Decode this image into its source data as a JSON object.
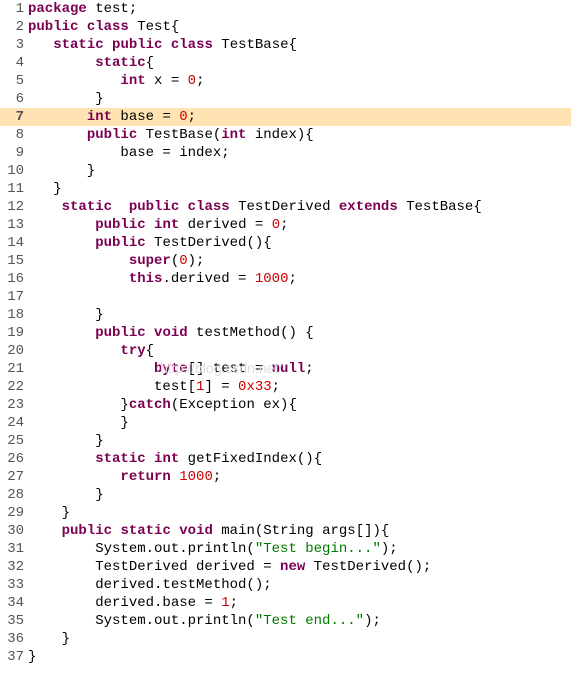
{
  "lines": [
    {
      "n": "1",
      "hl": false,
      "seg": [
        [
          "kw",
          "package"
        ],
        [
          "",
          " test;"
        ]
      ]
    },
    {
      "n": "2",
      "hl": false,
      "seg": [
        [
          "kw",
          "public"
        ],
        [
          "",
          " "
        ],
        [
          "kw",
          "class"
        ],
        [
          "",
          " Test{"
        ]
      ]
    },
    {
      "n": "3",
      "hl": false,
      "seg": [
        [
          "",
          "   "
        ],
        [
          "kw",
          "static"
        ],
        [
          "",
          " "
        ],
        [
          "kw",
          "public"
        ],
        [
          "",
          " "
        ],
        [
          "kw",
          "class"
        ],
        [
          "",
          " TestBase{"
        ]
      ]
    },
    {
      "n": "4",
      "hl": false,
      "seg": [
        [
          "",
          "        "
        ],
        [
          "kw",
          "static"
        ],
        [
          "",
          "{"
        ]
      ]
    },
    {
      "n": "5",
      "hl": false,
      "seg": [
        [
          "",
          "           "
        ],
        [
          "kw",
          "int"
        ],
        [
          "",
          " x = "
        ],
        [
          "num",
          "0"
        ],
        [
          "",
          ";"
        ]
      ]
    },
    {
      "n": "6",
      "hl": false,
      "seg": [
        [
          "",
          "        }"
        ]
      ]
    },
    {
      "n": "7",
      "hl": true,
      "seg": [
        [
          "",
          "       "
        ],
        [
          "kw",
          "int"
        ],
        [
          "",
          " base = "
        ],
        [
          "num",
          "0"
        ],
        [
          "",
          ";"
        ]
      ]
    },
    {
      "n": "8",
      "hl": false,
      "seg": [
        [
          "",
          "       "
        ],
        [
          "kw",
          "public"
        ],
        [
          "",
          " TestBase("
        ],
        [
          "kw",
          "int"
        ],
        [
          "",
          " index){"
        ]
      ]
    },
    {
      "n": "9",
      "hl": false,
      "seg": [
        [
          "",
          "           base = index;"
        ]
      ]
    },
    {
      "n": "10",
      "hl": false,
      "seg": [
        [
          "",
          "       }"
        ]
      ]
    },
    {
      "n": "11",
      "hl": false,
      "seg": [
        [
          "",
          "   }"
        ]
      ]
    },
    {
      "n": "12",
      "hl": false,
      "seg": [
        [
          "",
          "    "
        ],
        [
          "kw",
          "static"
        ],
        [
          "",
          "  "
        ],
        [
          "kw",
          "public"
        ],
        [
          "",
          " "
        ],
        [
          "kw",
          "class"
        ],
        [
          "",
          " TestDerived "
        ],
        [
          "kw",
          "extends"
        ],
        [
          "",
          " TestBase{"
        ]
      ]
    },
    {
      "n": "13",
      "hl": false,
      "seg": [
        [
          "",
          "        "
        ],
        [
          "kw",
          "public"
        ],
        [
          "",
          " "
        ],
        [
          "kw",
          "int"
        ],
        [
          "",
          " derived = "
        ],
        [
          "num",
          "0"
        ],
        [
          "",
          ";"
        ]
      ]
    },
    {
      "n": "14",
      "hl": false,
      "seg": [
        [
          "",
          "        "
        ],
        [
          "kw",
          "public"
        ],
        [
          "",
          " TestDerived(){"
        ]
      ]
    },
    {
      "n": "15",
      "hl": false,
      "seg": [
        [
          "",
          "            "
        ],
        [
          "kw",
          "super"
        ],
        [
          "",
          "("
        ],
        [
          "num",
          "0"
        ],
        [
          "",
          ");"
        ]
      ]
    },
    {
      "n": "16",
      "hl": false,
      "seg": [
        [
          "",
          "            "
        ],
        [
          "kw",
          "this"
        ],
        [
          "",
          ".derived = "
        ],
        [
          "num",
          "1000"
        ],
        [
          "",
          ";"
        ]
      ]
    },
    {
      "n": "17",
      "hl": false,
      "seg": [
        [
          "",
          ""
        ]
      ]
    },
    {
      "n": "18",
      "hl": false,
      "seg": [
        [
          "",
          "        }"
        ]
      ]
    },
    {
      "n": "19",
      "hl": false,
      "seg": [
        [
          "",
          "        "
        ],
        [
          "kw",
          "public"
        ],
        [
          "",
          " "
        ],
        [
          "kw",
          "void"
        ],
        [
          "",
          " testMethod() {"
        ]
      ]
    },
    {
      "n": "20",
      "hl": false,
      "seg": [
        [
          "",
          "           "
        ],
        [
          "kw",
          "try"
        ],
        [
          "",
          "{"
        ]
      ]
    },
    {
      "n": "21",
      "hl": false,
      "seg": [
        [
          "",
          "               "
        ],
        [
          "kw",
          "byte"
        ],
        [
          "",
          "[] test = "
        ],
        [
          "kw",
          "null"
        ],
        [
          "",
          ";"
        ]
      ]
    },
    {
      "n": "22",
      "hl": false,
      "seg": [
        [
          "",
          "               test["
        ],
        [
          "num",
          "1"
        ],
        [
          "",
          "] = "
        ],
        [
          "num",
          "0x33"
        ],
        [
          "",
          ";"
        ]
      ]
    },
    {
      "n": "23",
      "hl": false,
      "seg": [
        [
          "",
          "           }"
        ],
        [
          "kw",
          "catch"
        ],
        [
          "",
          "(Exception ex){"
        ]
      ]
    },
    {
      "n": "24",
      "hl": false,
      "seg": [
        [
          "",
          "           }"
        ]
      ]
    },
    {
      "n": "25",
      "hl": false,
      "seg": [
        [
          "",
          "        }"
        ]
      ]
    },
    {
      "n": "26",
      "hl": false,
      "seg": [
        [
          "",
          "        "
        ],
        [
          "kw",
          "static"
        ],
        [
          "",
          " "
        ],
        [
          "kw",
          "int"
        ],
        [
          "",
          " getFixedIndex(){"
        ]
      ]
    },
    {
      "n": "27",
      "hl": false,
      "seg": [
        [
          "",
          "           "
        ],
        [
          "kw",
          "return"
        ],
        [
          "",
          " "
        ],
        [
          "num",
          "1000"
        ],
        [
          "",
          ";"
        ]
      ]
    },
    {
      "n": "28",
      "hl": false,
      "seg": [
        [
          "",
          "        }"
        ]
      ]
    },
    {
      "n": "29",
      "hl": false,
      "seg": [
        [
          "",
          "    }"
        ]
      ]
    },
    {
      "n": "30",
      "hl": false,
      "seg": [
        [
          "",
          "    "
        ],
        [
          "kw",
          "public"
        ],
        [
          "",
          " "
        ],
        [
          "kw",
          "static"
        ],
        [
          "",
          " "
        ],
        [
          "kw",
          "void"
        ],
        [
          "",
          " main(String args[]){"
        ]
      ]
    },
    {
      "n": "31",
      "hl": false,
      "seg": [
        [
          "",
          "        System.out.println("
        ],
        [
          "str",
          "\"Test begin...\""
        ],
        [
          "",
          ");"
        ]
      ]
    },
    {
      "n": "32",
      "hl": false,
      "seg": [
        [
          "",
          "        TestDerived derived = "
        ],
        [
          "kw",
          "new"
        ],
        [
          "",
          " TestDerived();"
        ]
      ]
    },
    {
      "n": "33",
      "hl": false,
      "seg": [
        [
          "",
          "        derived.testMethod();"
        ]
      ]
    },
    {
      "n": "34",
      "hl": false,
      "seg": [
        [
          "",
          "        derived.base = "
        ],
        [
          "num",
          "1"
        ],
        [
          "",
          ";"
        ]
      ]
    },
    {
      "n": "35",
      "hl": false,
      "seg": [
        [
          "",
          "        System.out.println("
        ],
        [
          "str",
          "\"Test end...\""
        ],
        [
          "",
          ");"
        ]
      ]
    },
    {
      "n": "36",
      "hl": false,
      "seg": [
        [
          "",
          "    }"
        ]
      ]
    },
    {
      "n": "37",
      "hl": false,
      "seg": [
        [
          "",
          "}"
        ]
      ]
    }
  ],
  "watermark": "http://blog.csdn.net/"
}
